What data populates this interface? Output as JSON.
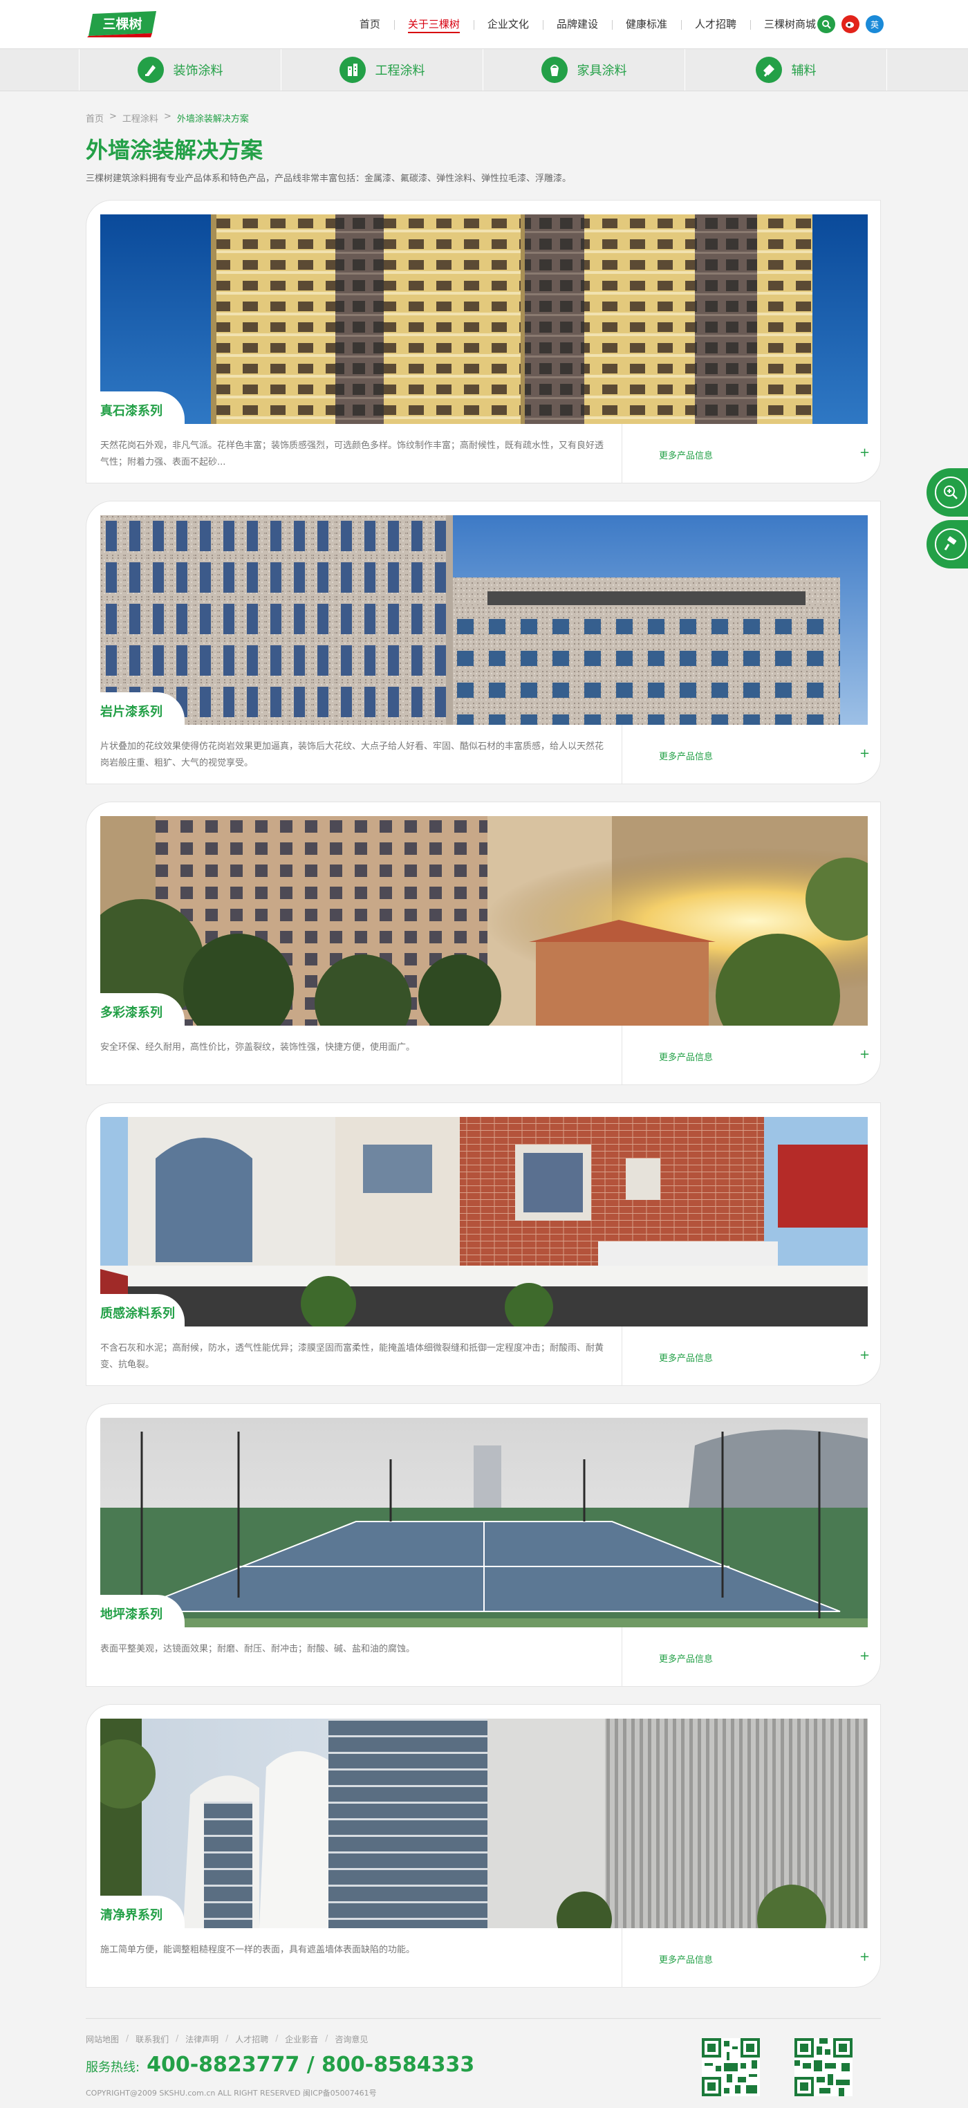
{
  "header": {
    "logo_text": "三棵树",
    "nav": [
      {
        "label": "首页",
        "active": false
      },
      {
        "label": "关于三棵树",
        "active": true
      },
      {
        "label": "企业文化",
        "active": false
      },
      {
        "label": "品牌建设",
        "active": false
      },
      {
        "label": "健康标准",
        "active": false
      },
      {
        "label": "人才招聘",
        "active": false
      },
      {
        "label": "三棵树商城",
        "active": false
      }
    ],
    "icons": [
      {
        "name": "search-icon",
        "color": "#23a047"
      },
      {
        "name": "weibo-icon",
        "color": "#e2231a"
      },
      {
        "name": "language-icon",
        "label": "英",
        "color": "#1a8ad8"
      }
    ]
  },
  "categories": [
    {
      "label": "装饰涂料",
      "icon": "paint-brush-icon"
    },
    {
      "label": "工程涂料",
      "icon": "building-icon"
    },
    {
      "label": "家具涂料",
      "icon": "paint-bucket-icon"
    },
    {
      "label": "辅料",
      "icon": "trowel-icon"
    }
  ],
  "breadcrumb": {
    "items": [
      "首页",
      "工程涂料"
    ],
    "current": "外墙涂装解决方案",
    "separator": ">"
  },
  "page": {
    "title": "外墙涂装解决方案",
    "intro": "三棵树建筑涂料拥有专业产品体系和特色产品，产品线非常丰富包括：金属漆、氟碳漆、弹性涂料、弹性拉毛漆、浮雕漆。"
  },
  "products": [
    {
      "title": "真石漆系列",
      "desc": "天然花岗石外观，非凡气派。花样色丰富；装饰质感强烈，可选颜色多样。饰纹制作丰富；高耐候性，既有疏水性，又有良好透气性；附着力强、表面不起砂...",
      "more": "更多产品信息",
      "image": "apartment-towers"
    },
    {
      "title": "岩片漆系列",
      "desc": "片状叠加的花纹效果使得仿花岗岩效果更加逼真，装饰后大花纹、大点子给人好看、牢固、酷似石材的丰富质感，给人以天然花岗岩般庄重、粗犷、大气的视觉享受。",
      "more": "更多产品信息",
      "image": "granite-buildings"
    },
    {
      "title": "多彩漆系列",
      "desc": "安全环保、经久耐用，高性价比，弥盖裂纹，装饰性强，快捷方便，使用面广。",
      "more": "更多产品信息",
      "image": "residential-sunset"
    },
    {
      "title": "质感涂料系列",
      "desc": "不含石灰和水泥；高耐候，防水，透气性能优异；漆膜坚固而富柔性，能掩盖墙体细微裂缝和抵御一定程度冲击；耐酸雨、耐黄变、抗龟裂。",
      "more": "更多产品信息",
      "image": "brick-villa"
    },
    {
      "title": "地坪漆系列",
      "desc": "表面平整美观，达镜面效果；耐磨、耐压、耐冲击；耐酸、碱、盐和油的腐蚀。",
      "more": "更多产品信息",
      "image": "tennis-court"
    },
    {
      "title": "清净界系列",
      "desc": "施工简单方便，能调整粗糙程度不一样的表面，具有遮盖墙体表面缺陷的功能。",
      "more": "更多产品信息",
      "image": "modern-facade"
    }
  ],
  "side_buttons": [
    {
      "name": "zoom-search-icon"
    },
    {
      "name": "paint-roller-icon"
    }
  ],
  "footer": {
    "links": [
      "网站地图",
      "联系我们",
      "法律声明",
      "人才招聘",
      "企业影音",
      "咨询意见"
    ],
    "hotline_label": "服务热线:",
    "hotline_numbers": "400-8823777 / 800-8584333",
    "copyright": "COPYRIGHT@2009 SKSHU.com.cn ALL RIGHT RESERVED 闽ICP备05007461号"
  },
  "colors": {
    "brand_green": "#23a047",
    "active_red": "#d7000f"
  }
}
